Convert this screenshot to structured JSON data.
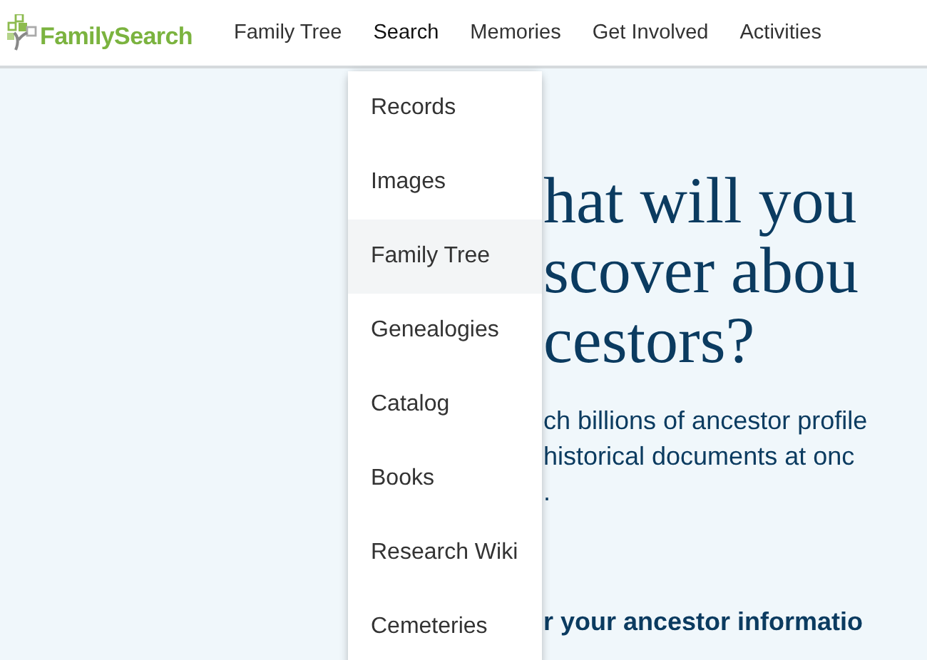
{
  "header": {
    "logo": "FamilySearch",
    "nav": [
      {
        "label": "Family Tree",
        "expanded": false
      },
      {
        "label": "Search",
        "expanded": true
      },
      {
        "label": "Memories",
        "expanded": false
      },
      {
        "label": "Get Involved",
        "expanded": false
      },
      {
        "label": "Activities",
        "expanded": false
      }
    ]
  },
  "menu": {
    "items": [
      {
        "label": "Records",
        "hovered": false
      },
      {
        "label": "Images",
        "hovered": false
      },
      {
        "label": "Family Tree",
        "hovered": true
      },
      {
        "label": "Genealogies",
        "hovered": false
      },
      {
        "label": "Catalog",
        "hovered": false
      },
      {
        "label": "Books",
        "hovered": false
      },
      {
        "label": "Research Wiki",
        "hovered": false
      },
      {
        "label": "Cemeteries",
        "hovered": false
      }
    ]
  },
  "hero": {
    "heading_lines": [
      "hat will you",
      "scover abou",
      "cestors?"
    ],
    "body_lines": [
      "ch billions of ancestor profile",
      "historical documents at onc",
      "."
    ],
    "subheading": "r your ancestor informatio"
  }
}
